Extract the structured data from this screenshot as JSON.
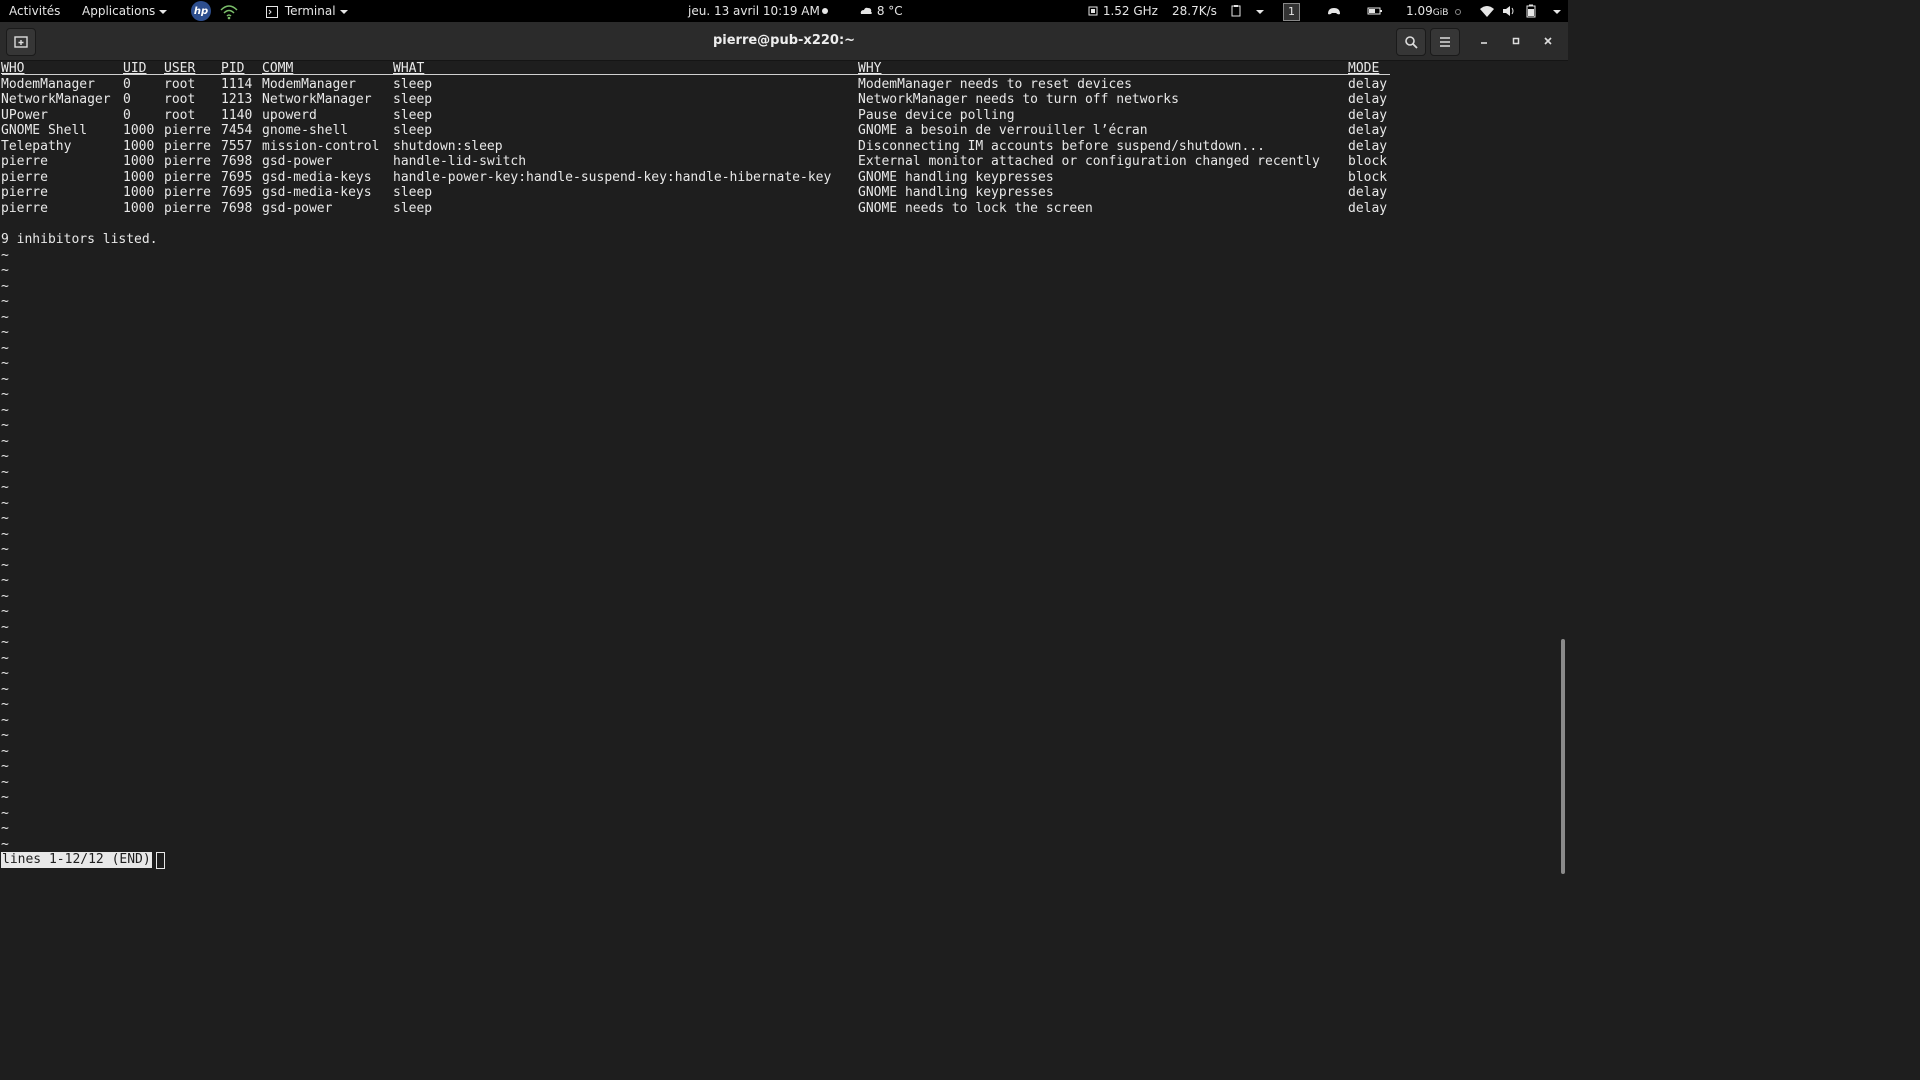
{
  "topbar": {
    "activities": "Activités",
    "applications": "Applications",
    "hp_logo": "hp",
    "app_menu": "Terminal",
    "clock": "jeu. 13 avril 10:19 AM",
    "weather": "8 °C",
    "cpu_freq": "1.52 GHz",
    "net_speed": "28.7K/s",
    "workspace": "1",
    "storage": "1.09",
    "storage_unit": "GiB"
  },
  "window": {
    "title": "pierre@pub-x220:~"
  },
  "table": {
    "headers": [
      "WHO",
      "UID",
      "USER",
      "PID",
      "COMM",
      "WHAT",
      "WHY",
      "MODE"
    ],
    "rows": [
      [
        "ModemManager",
        "0",
        "root",
        "1114",
        "ModemManager",
        "sleep",
        "ModemManager needs to reset devices",
        "delay"
      ],
      [
        "NetworkManager",
        "0",
        "root",
        "1213",
        "NetworkManager",
        "sleep",
        "NetworkManager needs to turn off networks",
        "delay"
      ],
      [
        "UPower",
        "0",
        "root",
        "1140",
        "upowerd",
        "sleep",
        "Pause device polling",
        "delay"
      ],
      [
        "GNOME Shell",
        "1000",
        "pierre",
        "7454",
        "gnome-shell",
        "sleep",
        "GNOME a besoin de verrouiller l’écran",
        "delay"
      ],
      [
        "Telepathy",
        "1000",
        "pierre",
        "7557",
        "mission-control",
        "shutdown:sleep",
        "Disconnecting IM accounts before suspend/shutdown...",
        "delay"
      ],
      [
        "pierre",
        "1000",
        "pierre",
        "7698",
        "gsd-power",
        "handle-lid-switch",
        "External monitor attached or configuration changed recently",
        "block"
      ],
      [
        "pierre",
        "1000",
        "pierre",
        "7695",
        "gsd-media-keys",
        "handle-power-key:handle-suspend-key:handle-hibernate-key",
        "GNOME handling keypresses",
        "block"
      ],
      [
        "pierre",
        "1000",
        "pierre",
        "7695",
        "gsd-media-keys",
        "sleep",
        "GNOME handling keypresses",
        "delay"
      ],
      [
        "pierre",
        "1000",
        "pierre",
        "7698",
        "gsd-power",
        "sleep",
        "GNOME needs to lock the screen",
        "delay"
      ]
    ]
  },
  "summary": "9 inhibitors listed.",
  "tilde_char": "~",
  "tilde_count": 39,
  "pager_status": "lines 1-12/12 (END)"
}
